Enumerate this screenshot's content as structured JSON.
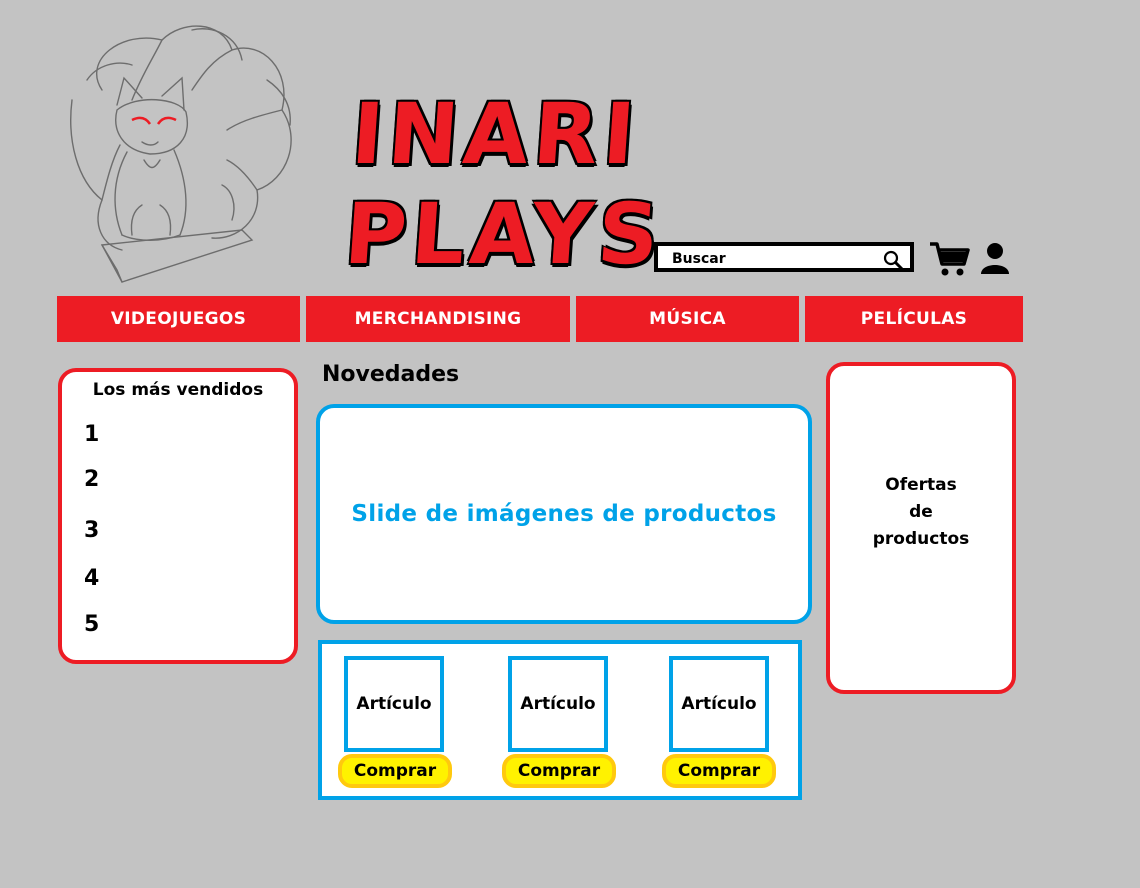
{
  "header": {
    "brand_title": "INARI PLAYS",
    "logo_icon": "fox-mascot-logo"
  },
  "search": {
    "placeholder": "Buscar"
  },
  "icons": {
    "search": "search-icon",
    "cart": "cart-icon",
    "user": "user-icon"
  },
  "nav": {
    "items": [
      {
        "label": "VIDEOJUEGOS"
      },
      {
        "label": "MERCHANDISING"
      },
      {
        "label": "MÚSICA"
      },
      {
        "label": "PELÍCULAS"
      }
    ]
  },
  "bestsellers": {
    "title": "Los más vendidos",
    "ranks": [
      "1",
      "2",
      "3",
      "4",
      "5"
    ]
  },
  "news": {
    "title": "Novedades",
    "slider_text": "Slide de imágenes de productos"
  },
  "products": [
    {
      "label": "Artículo",
      "button": "Comprar"
    },
    {
      "label": "Artículo",
      "button": "Comprar"
    },
    {
      "label": "Artículo",
      "button": "Comprar"
    }
  ],
  "offers": {
    "text": "Ofertas\nde\nproductos"
  },
  "colors": {
    "background": "#c3c3c3",
    "accent_red": "#ed1c24",
    "accent_blue": "#00a2e8",
    "button_yellow": "#fff200"
  }
}
